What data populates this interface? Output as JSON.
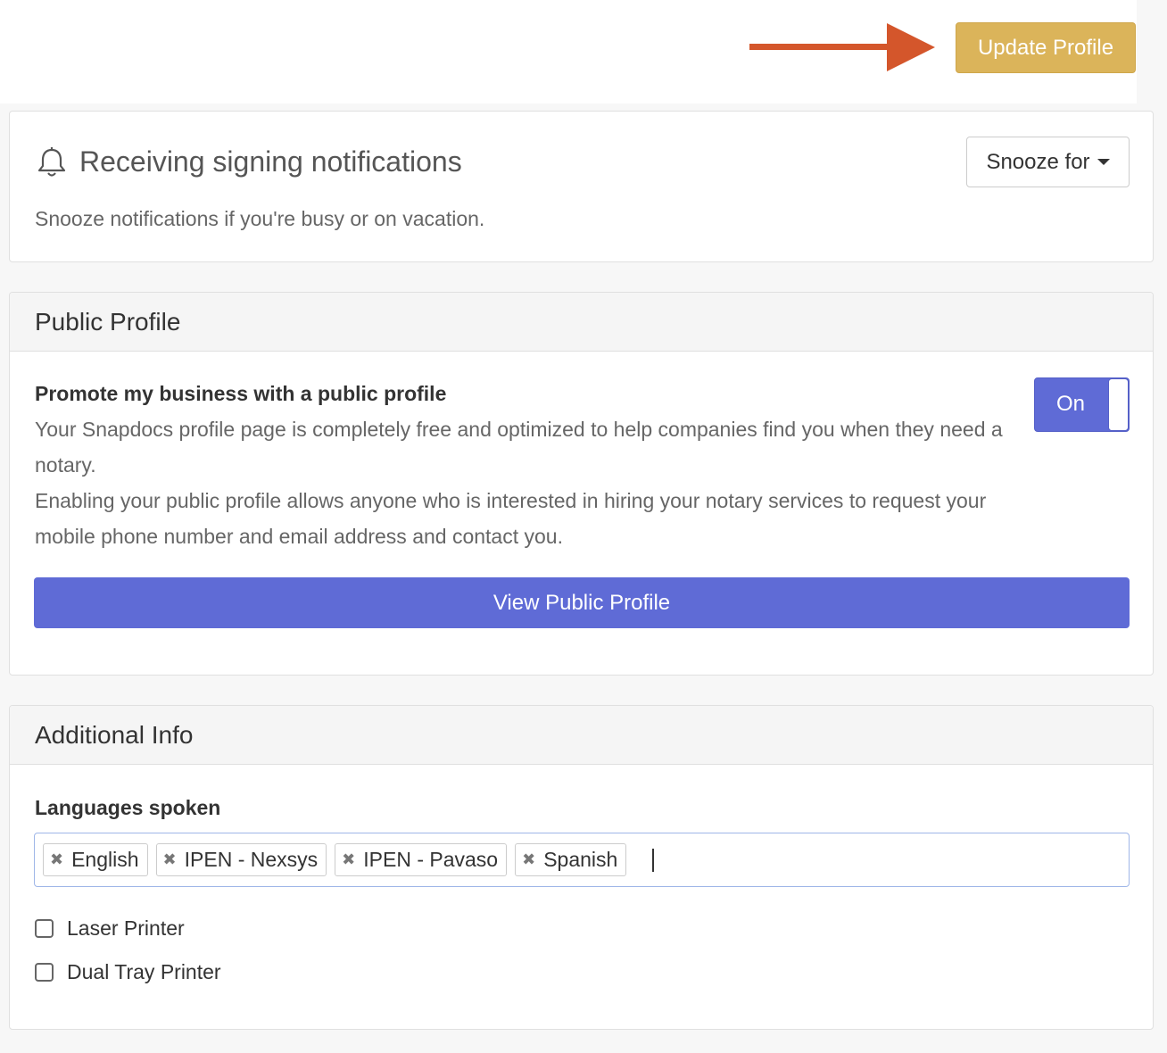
{
  "header": {
    "update_profile_label": "Update Profile",
    "accent_color": "#dbb45a",
    "arrow_color": "#d4562b"
  },
  "notifications": {
    "title": "Receiving signing notifications",
    "icon": "bell-icon",
    "description": "Snooze notifications if you're busy or on vacation.",
    "snooze_label": "Snooze for"
  },
  "public_profile": {
    "header": "Public Profile",
    "promo_title": "Promote my business with a public profile",
    "promo_text_1": "Your Snapdocs profile page is completely free and optimized to help companies find you when they need a notary.",
    "promo_text_2": "Enabling your public profile allows anyone who is interested in hiring your notary services to request your mobile phone number and email address and contact you.",
    "toggle_label": "On",
    "toggle_state": true,
    "view_button_label": "View Public Profile",
    "primary_color": "#5f6bd6"
  },
  "additional_info": {
    "header": "Additional Info",
    "languages_label": "Languages spoken",
    "languages": [
      "English",
      "IPEN - Nexsys",
      "IPEN - Pavaso",
      "Spanish"
    ],
    "remove_glyph": "✖",
    "checkboxes": [
      {
        "label": "Laser Printer",
        "checked": false
      },
      {
        "label": "Dual Tray Printer",
        "checked": false
      }
    ]
  }
}
